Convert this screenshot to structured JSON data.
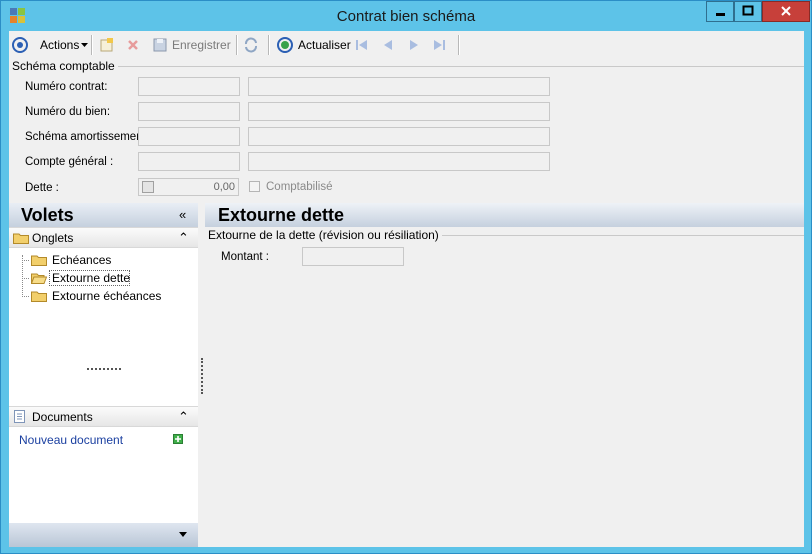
{
  "window": {
    "title": "Contrat bien schéma",
    "colors": {
      "frame": "#5dc3e8",
      "close": "#c7403a",
      "content": "#f0f0f0"
    }
  },
  "toolbar": {
    "actions_label": "Actions",
    "save_label": "Enregistrer",
    "refresh_label": "Actualiser"
  },
  "form": {
    "group_title": "Schéma comptable",
    "fields": [
      {
        "label": "Numéro contrat:"
      },
      {
        "label": "Numéro du bien:"
      },
      {
        "label": "Schéma amortissement"
      },
      {
        "label": "Compte général :"
      }
    ],
    "dette": {
      "label": "Dette :",
      "value": "0,00",
      "checkbox_label": "Comptabilisé"
    }
  },
  "left_panel": {
    "title": "Volets",
    "onglets": {
      "title": "Onglets",
      "items": [
        "Echéances",
        "Extourne dette",
        "Extourne échéances"
      ],
      "selected_index": 1
    },
    "documents": {
      "title": "Documents",
      "new_doc_label": "Nouveau document"
    }
  },
  "content": {
    "title": "Extourne dette",
    "group_title": "Extourne de la dette (révision ou résiliation)",
    "montant_label": "Montant :"
  }
}
